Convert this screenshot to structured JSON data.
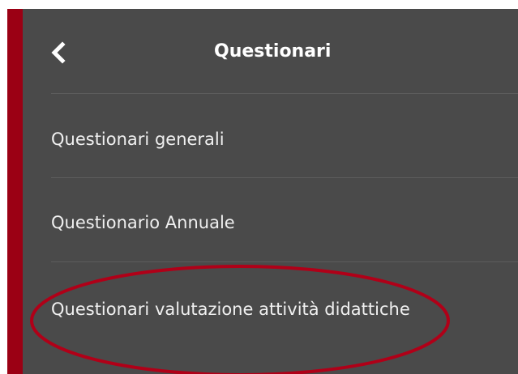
{
  "header": {
    "title": "Questionari",
    "back_icon": "chevron-left-icon"
  },
  "menu": {
    "items": [
      {
        "label": "Questionari generali"
      },
      {
        "label": "Questionario Annuale"
      },
      {
        "label": "Questionari valutazione attività didattiche"
      }
    ]
  },
  "colors": {
    "panel_background": "#4a4a4a",
    "accent_bar": "#9b0014",
    "annotation_ellipse": "#b00018",
    "text": "#f0f0f0"
  }
}
